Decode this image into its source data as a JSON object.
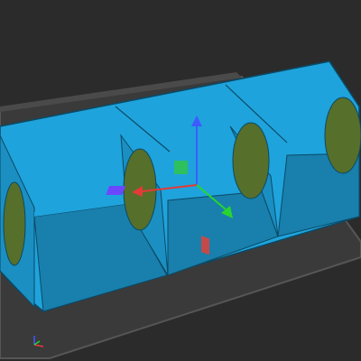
{
  "viewport": {
    "background_color": "#2b2b2b",
    "bed_color": "#3a3a3a",
    "bed_edge_color": "#565656",
    "model_color": "#1fa3dc",
    "model_dark_color": "#197fac",
    "model_outline_color": "#0a4a66",
    "hole_color": "#566f2a"
  },
  "gizmo": {
    "x_axis_color": "#e33b36",
    "y_axis_color": "#28d431",
    "z_axis_color": "#3d5bff",
    "xy_plane_color": "#6a48ff",
    "yz_plane_color": "#c44a4a",
    "xz_plane_color": "#2ec05e",
    "icons": [
      "move-x-arrow-icon",
      "move-y-arrow-icon",
      "move-z-arrow-icon"
    ]
  },
  "origin_marker": {
    "icon": "world-axes-icon"
  }
}
